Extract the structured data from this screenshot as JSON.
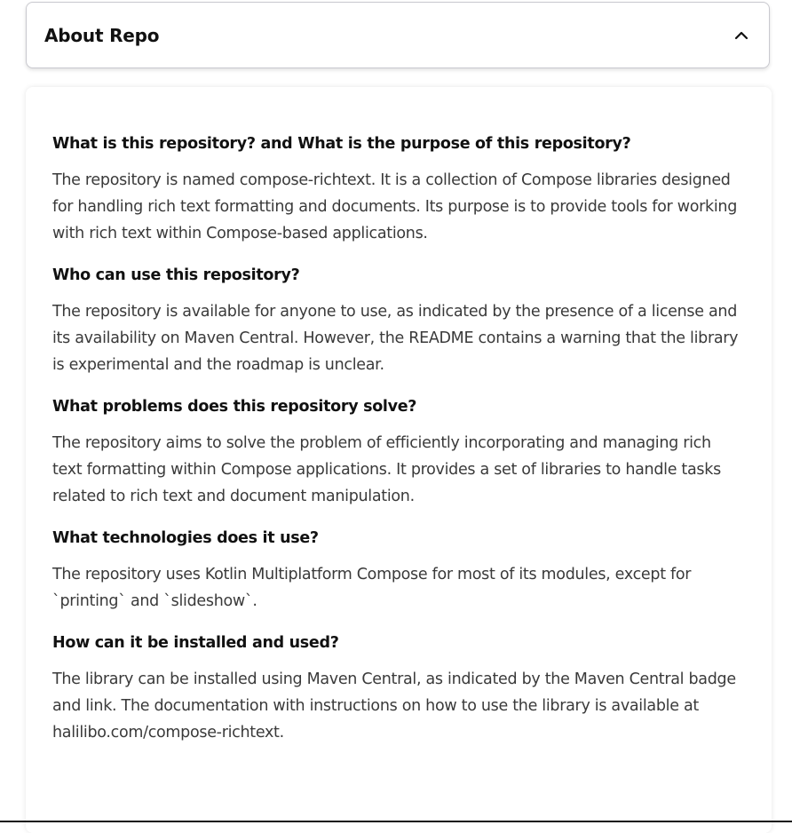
{
  "header": {
    "title": "About Repo",
    "toggle_icon": "chevron-up-icon"
  },
  "qa": [
    {
      "question": "What is this repository? and What is the purpose of this repository?",
      "answer": "The repository is named compose-richtext. It is a collection of Compose libraries designed for handling rich text formatting and documents. Its purpose is to provide tools for working with rich text within Compose-based applications."
    },
    {
      "question": "Who can use this repository?",
      "answer": "The repository is available for anyone to use, as indicated by the presence of a license and its availability on Maven Central. However, the README contains a warning that the library is experimental and the roadmap is unclear."
    },
    {
      "question": "What problems does this repository solve?",
      "answer": "The repository aims to solve the problem of efficiently incorporating and managing rich text formatting within Compose applications. It provides a set of libraries to handle tasks related to rich text and document manipulation."
    },
    {
      "question": "What technologies does it use?",
      "answer": "The repository uses Kotlin Multiplatform Compose for most of its modules, except for `printing` and `slideshow`."
    },
    {
      "question": "How can it be installed and used?",
      "answer": "The library can be installed using Maven Central, as indicated by the Maven Central badge and link. The documentation with instructions on how to use the library is available at halilibo.com/compose-richtext."
    }
  ]
}
